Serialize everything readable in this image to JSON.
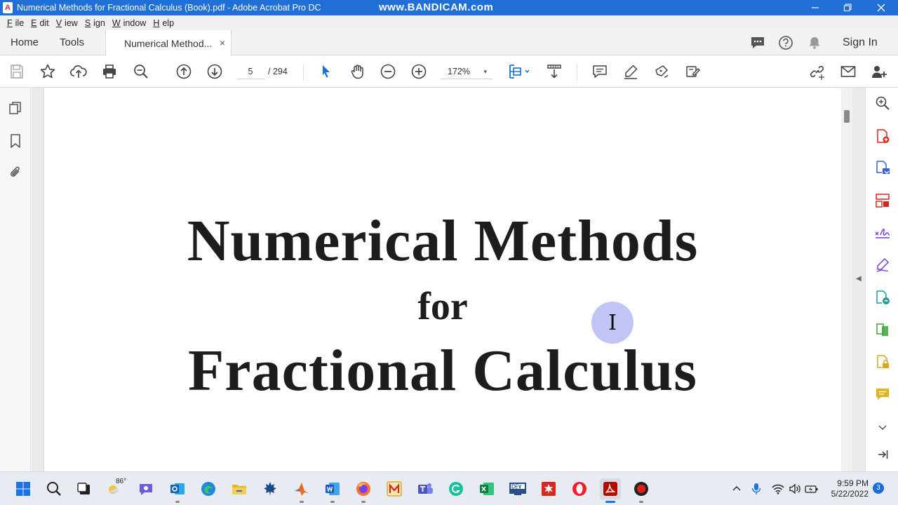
{
  "window": {
    "title": "Numerical Methods for Fractional Calculus (Book).pdf - Adobe Acrobat Pro DC",
    "watermark": "www.BANDICAM.com",
    "app_icon": "acrobat-icon",
    "controls": [
      "minimize-icon",
      "restore-icon",
      "close-icon"
    ]
  },
  "menu": {
    "items": [
      {
        "key": "F",
        "rest": "ile"
      },
      {
        "key": "E",
        "rest": "dit"
      },
      {
        "key": "V",
        "rest": "iew"
      },
      {
        "key": "S",
        "rest": "ign"
      },
      {
        "key": "W",
        "rest": "indow"
      },
      {
        "key": "H",
        "rest": "elp"
      }
    ]
  },
  "tabs": {
    "home": "Home",
    "tools": "Tools",
    "document": "Numerical Method...",
    "close": "×",
    "sign_in": "Sign In"
  },
  "toolbar": {
    "page_current": "5",
    "page_total": "/ 294",
    "zoom": "172%",
    "zoom_caret": "▾",
    "icons": [
      "save-icon",
      "star-icon",
      "upload-icon",
      "print-icon",
      "zoom-search-icon",
      "page-up-icon",
      "page-down-icon",
      "select-cursor-icon",
      "hand-icon",
      "zoom-out-icon",
      "zoom-in-icon",
      "page-fit-icon",
      "scroll-mode-icon",
      "comment-icon",
      "highlight-icon",
      "draw-icon",
      "fill-sign-icon",
      "share-link-icon",
      "email-icon",
      "add-user-icon"
    ]
  },
  "document": {
    "title_line1": "Numerical Methods",
    "title_line2": "for",
    "title_line3": "Fractional Calculus",
    "cursor_glyph": "I"
  },
  "panes": {
    "left_collapse": "◀",
    "right_collapse": "◀"
  },
  "taskbar": {
    "weather": "86°",
    "time": "9:59 PM",
    "date": "5/22/2022",
    "notifications": "3"
  },
  "colors": {
    "titlebar": "#1f6fd6",
    "acrobat_red": "#d6281e",
    "accent_blue": "#1a73e8"
  }
}
